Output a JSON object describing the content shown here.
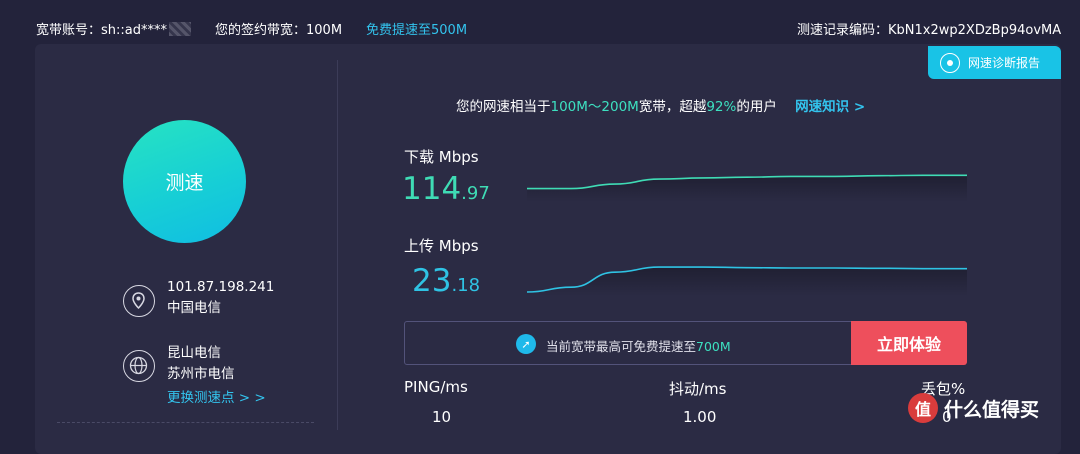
{
  "topbar": {
    "account_label": "宽带账号：",
    "account_value": "sh::ad****",
    "contract_label": "您的签约带宽：",
    "contract_value": "100M",
    "upgrade_link": "免费提速至500M",
    "record_label": "测速记录编码：",
    "record_value": "KbN1x2wp2XDzBp94ovMA"
  },
  "diag_button": {
    "label": "网速诊断报告",
    "icon": "location-pin-icon"
  },
  "left": {
    "speed_button": "测速",
    "ip": "101.87.198.241",
    "isp": "中国电信",
    "node_line1": "昆山电信",
    "node_line2": "苏州市电信",
    "change_node": "更换测速点 > >",
    "icons": [
      "location-pin-icon",
      "globe-icon"
    ]
  },
  "headline": {
    "prefix": "您的网速相当于",
    "range": "100M～200M",
    "middle": "宽带，超越",
    "percent": "92%",
    "suffix": "的用户",
    "link": "网速知识 >"
  },
  "download": {
    "label": "下载 Mbps",
    "int": "114",
    "dec": ".97",
    "trend": [
      0.3,
      0.3,
      0.42,
      0.55,
      0.58,
      0.6,
      0.62,
      0.62,
      0.64,
      0.65,
      0.65
    ]
  },
  "upload": {
    "label": "上传 Mbps",
    "int": "23",
    "dec": ".18",
    "trend": [
      0.0,
      0.15,
      0.62,
      0.78,
      0.78,
      0.76,
      0.75,
      0.75,
      0.74,
      0.73,
      0.73
    ]
  },
  "promo": {
    "text_prefix": "当前宽带最高可免费提速至",
    "text_value": "700M",
    "button": "立即体验",
    "icon": "rocket-icon"
  },
  "stats": {
    "ping_label": "PING/ms",
    "ping_value": "10",
    "jitter_label": "抖动/ms",
    "jitter_value": "1.00",
    "loss_label": "丢包%",
    "loss_value": "0"
  },
  "watermark": {
    "logo": "值",
    "text": "什么值得买"
  },
  "colors": {
    "accent_green": "#3fdcb5",
    "accent_cyan": "#2fc3e4",
    "cta_red": "#ee4f5c",
    "highlight": "#3de0c0",
    "link": "#33c4ee"
  }
}
